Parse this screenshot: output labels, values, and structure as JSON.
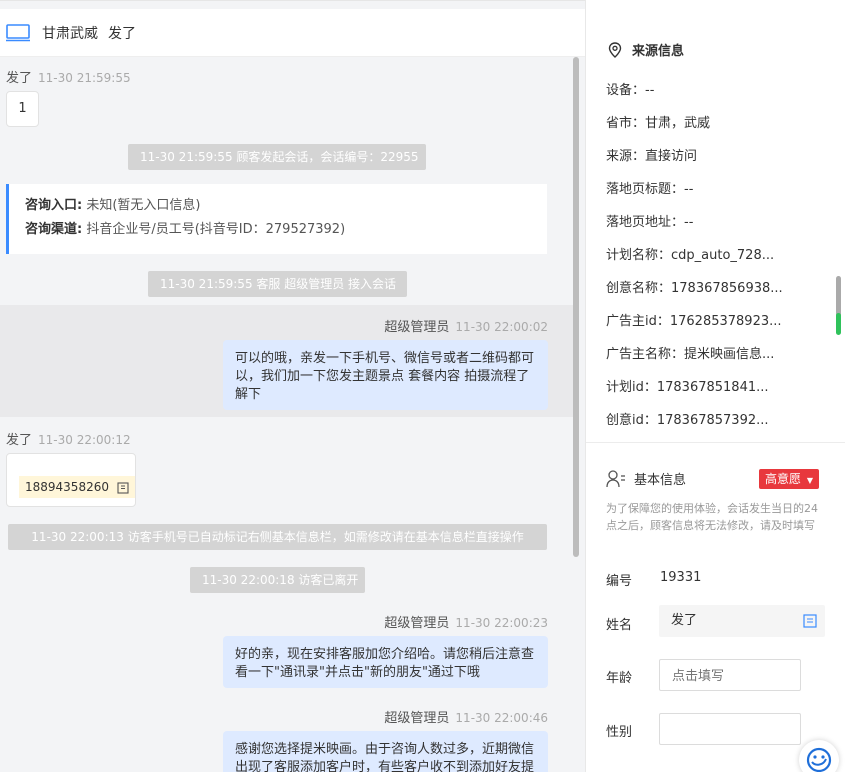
{
  "header": {
    "location": "甘肃武威",
    "customer_name": "发了"
  },
  "chat": {
    "msg1": {
      "sender": "发了",
      "time": "11-30 21:59:55",
      "text": "1"
    },
    "sys1": "11-30 21:59:55 顾客发起会话，会话编号：22955",
    "info_card": {
      "entry_label": "咨询入口:",
      "entry_value": "未知(暂无入口信息)",
      "channel_label": "咨询渠道:",
      "channel_value": "抖音企业号/员工号(抖音号ID：279527392)"
    },
    "sys2": "11-30 21:59:55 客服 超级管理员 接入会话",
    "agent1": {
      "sender": "超级管理员",
      "time": "11-30 22:00:02",
      "text": "可以的哦，亲发一下手机号、微信号或者二维码都可以，我们加一下您发主题景点 套餐内容 拍摄流程了解下"
    },
    "msg2": {
      "sender": "发了",
      "time": "11-30 22:00:12",
      "phone": "18894358260"
    },
    "sys3": "11-30 22:00:13 访客手机号已自动标记右侧基本信息栏，如需修改请在基本信息栏直接操作",
    "sys4": "11-30 22:00:18 访客已离开",
    "agent2": {
      "sender": "超级管理员",
      "time": "11-30 22:00:23",
      "text": "好的亲，现在安排客服加您介绍哈。请您稍后注意查看一下\"通讯录\"并点击\"新的朋友\"通过下哦"
    },
    "agent3": {
      "sender": "超级管理员",
      "time": "11-30 22:00:46",
      "text": "感谢您选择提米映画。由于咨询人数过多，近期微信出现了客服添加客户时，有些客户收不到添加好友提"
    }
  },
  "source_info": {
    "title": "来源信息",
    "rows": [
      "设备：--",
      "省市：甘肃，武威",
      "来源：直接访问",
      "落地页标题：--",
      "落地页地址：--",
      "计划名称：cdp_auto_728...",
      "创意名称：178367856938...",
      "广告主id：176285378923...",
      "广告主名称：提米映画信息...",
      "计划id：178367851841...",
      "创意id：178367857392..."
    ]
  },
  "basic_info": {
    "title": "基本信息",
    "intent_badge": "高意愿",
    "hint": "为了保障您的使用体验，会话发生当日的24点之后，顾客信息将无法修改，请及时填写",
    "number_label": "编号",
    "number_value": "19331",
    "name_label": "姓名",
    "name_value": "发了",
    "age_label": "年龄",
    "age_placeholder": "点击填写",
    "gender_label": "性别"
  },
  "colors": {
    "accent_blue": "#3a8bff",
    "agent_bubble": "#deeaff",
    "badge_red": "#e8383d",
    "system_pill": "#d4d4d4"
  }
}
